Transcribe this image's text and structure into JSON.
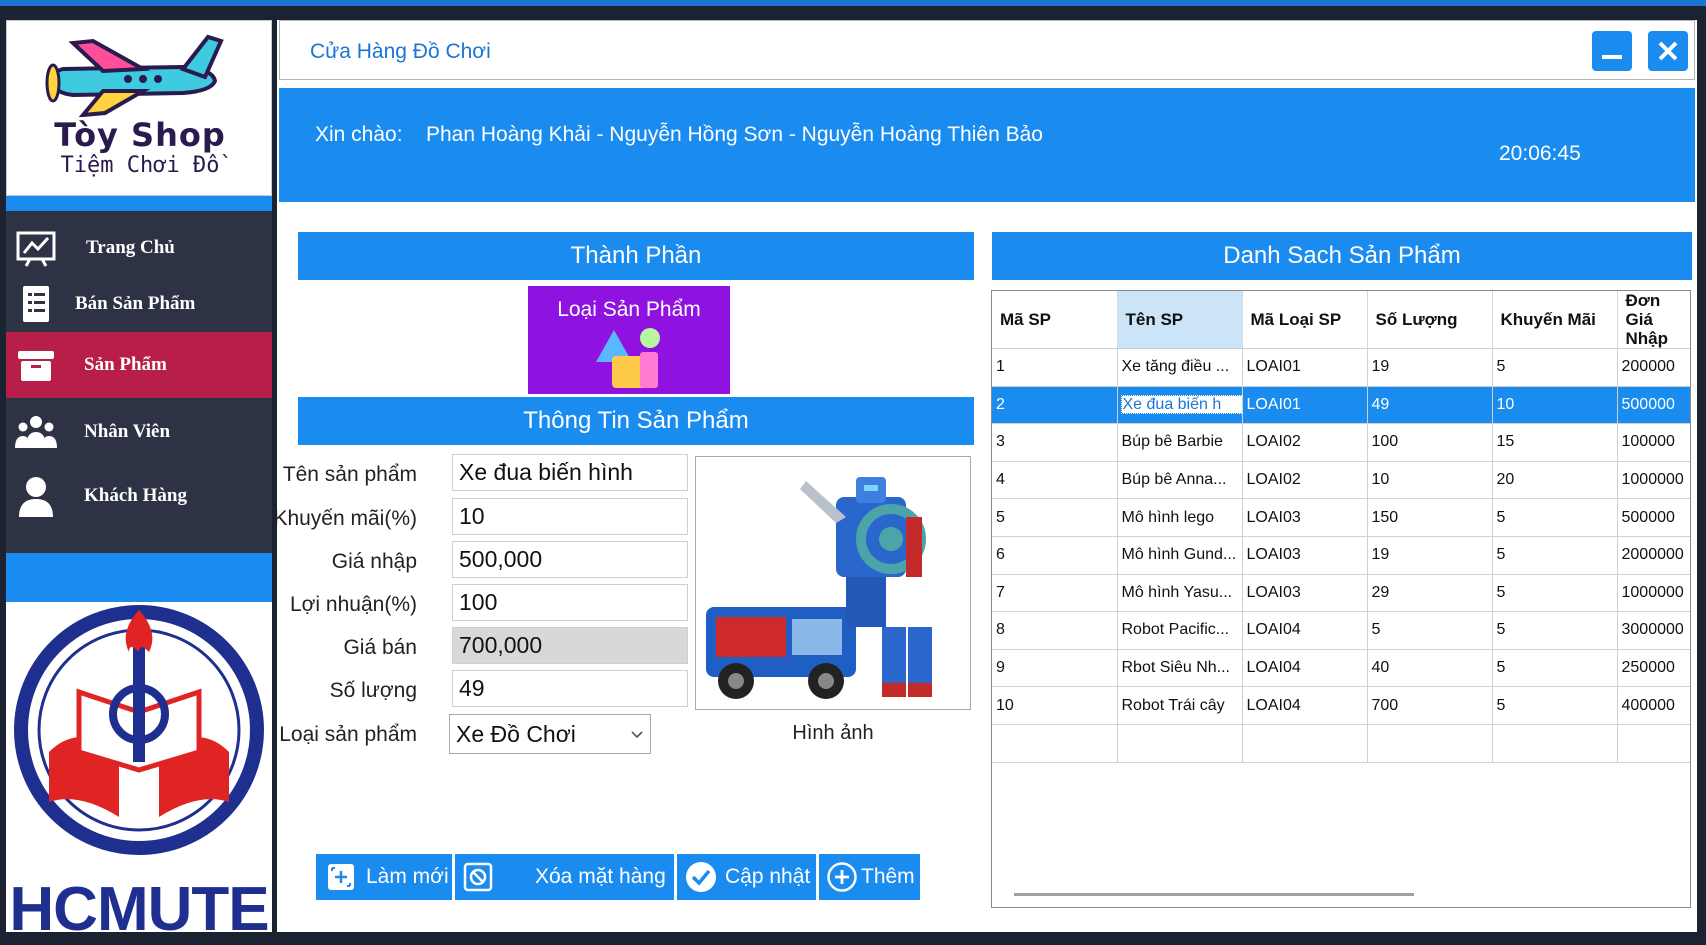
{
  "app": {
    "title": "Cửa Hàng Đồ Chơi"
  },
  "brand": {
    "name": "Tòy Shop",
    "tagline": "Tiệm Chơi Đồ",
    "school": "HCMUTE"
  },
  "header": {
    "greeting_label": "Xin chào:",
    "names": "Phan Hoàng Khải - Nguyễn Hồng Sơn - Nguyễn Hoàng Thiên Bảo",
    "clock": "20:06:45"
  },
  "nav": {
    "items": [
      {
        "label": "Trang Chủ",
        "icon": "chart-board-icon"
      },
      {
        "label": "Bán Sản Phẩm",
        "icon": "receipt-icon"
      },
      {
        "label": "Sản Phẩm",
        "icon": "archive-box-icon",
        "active": true
      },
      {
        "label": "Nhân Viên",
        "icon": "team-icon"
      },
      {
        "label": "Khách Hàng",
        "icon": "user-icon"
      }
    ]
  },
  "components": {
    "title": "Thành Phần",
    "category_button": "Loại Sản Phẩm"
  },
  "product_info": {
    "title": "Thông Tin Sản Phẩm",
    "fields": {
      "name": {
        "label": "Tên sản phẩm",
        "value": "Xe đua biến hình"
      },
      "discount": {
        "label": "Khuyến mãi(%)",
        "value": "10"
      },
      "cost": {
        "label": "Giá nhập",
        "value": "500,000"
      },
      "profit": {
        "label": "Lợi nhuận(%)",
        "value": "100"
      },
      "price": {
        "label": "Giá bán",
        "value": "700,000"
      },
      "quantity": {
        "label": "Số lượng",
        "value": "49"
      },
      "category": {
        "label": "Loại sản phẩm",
        "value": "Xe Đồ Chơi"
      }
    },
    "image_caption": "Hình ảnh"
  },
  "actions": {
    "refresh": "Làm mới",
    "delete": "Xóa mặt hàng",
    "update": "Cập nhật",
    "add": "Thêm"
  },
  "product_list": {
    "title": "Danh Sach Sản Phẩm",
    "columns": [
      "Mã SP",
      "Tên SP",
      "Mã Loại SP",
      "Số Lượng",
      "Khuyến Mãi",
      "Đơn Giá Nhập"
    ],
    "rows": [
      [
        "1",
        "Xe tăng điều ...",
        "LOAI01",
        "19",
        "5",
        "200000"
      ],
      [
        "2",
        "Xe đua biến hình",
        "LOAI01",
        "49",
        "10",
        "500000"
      ],
      [
        "3",
        "Búp bê Barbie",
        "LOAI02",
        "100",
        "15",
        "100000"
      ],
      [
        "4",
        "Búp bê Anna...",
        "LOAI02",
        "10",
        "20",
        "1000000"
      ],
      [
        "5",
        "Mô hình lego",
        "LOAI03",
        "150",
        "5",
        "500000"
      ],
      [
        "6",
        "Mô hình Gund...",
        "LOAI03",
        "19",
        "5",
        "2000000"
      ],
      [
        "7",
        "Mô hình Yasu...",
        "LOAI03",
        "29",
        "5",
        "1000000"
      ],
      [
        "8",
        "Robot Pacific...",
        "LOAI04",
        "5",
        "5",
        "3000000"
      ],
      [
        "9",
        "Rbot Siêu Nh...",
        "LOAI04",
        "40",
        "5",
        "250000"
      ],
      [
        "10",
        "Robot Trái cây",
        "LOAI04",
        "700",
        "5",
        "400000"
      ]
    ],
    "selected_row": 1
  },
  "colors": {
    "accent": "#1a8cf0",
    "sidebar": "#2e3245",
    "active": "#b71f48",
    "category_button": "#8f12e0"
  }
}
